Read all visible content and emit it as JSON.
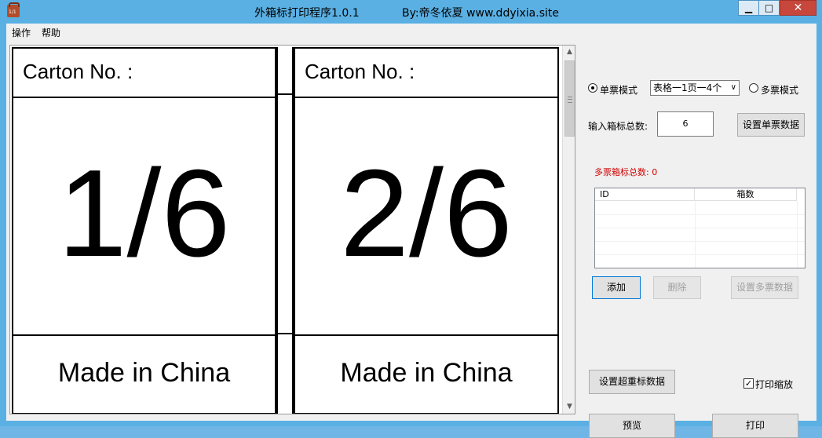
{
  "window": {
    "title_main": "外箱标打印程序1.0.1",
    "title_by": "By:帝冬依夏  www.ddyixia.site",
    "min_glyph": "▁",
    "max_glyph": "□",
    "close_glyph": "✕"
  },
  "menu": {
    "items": [
      "操作",
      "帮助"
    ]
  },
  "labels": [
    {
      "carton": "Carton No. :",
      "number": "1/6",
      "made": "Made in China"
    },
    {
      "carton": "Carton No. :",
      "number": "2/6",
      "made": "Made in China"
    }
  ],
  "panel": {
    "single_mode_label": "单票模式",
    "single_mode_checked": true,
    "layout_select_value": "表格一1页一4个",
    "multi_mode_label": "多票模式",
    "multi_mode_checked": false,
    "total_label": "输入箱标总数:",
    "total_value": "6",
    "set_single_button": "设置单票数据",
    "multi_total_label": "多票箱标总数: 0",
    "table_columns": [
      "ID",
      "箱数"
    ],
    "add_button": "添加",
    "delete_button": "删除",
    "set_multi_button": "设置多票数据",
    "set_overweight_button": "设置超重标数据",
    "print_scale_label": "打印缩放",
    "print_scale_checked": true,
    "preview_button": "预览",
    "print_button": "打印"
  },
  "colors": {
    "window_border": "#5ab0e3",
    "close_button": "#c7473d",
    "warning_text": "#d00000"
  }
}
